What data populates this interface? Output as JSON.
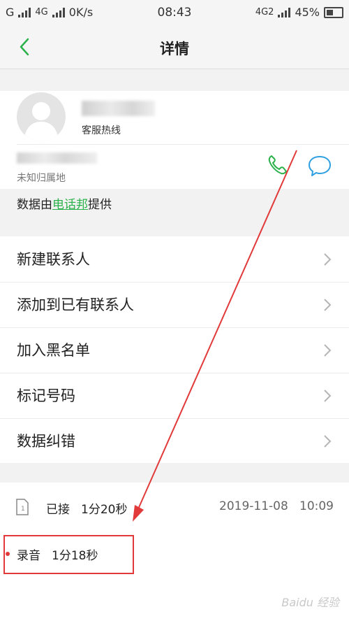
{
  "status_bar": {
    "network_left": "G",
    "network_mid": "4G",
    "speed": "0K/s",
    "time": "08:43",
    "network_right": "4G2",
    "battery_percent": "45%"
  },
  "nav": {
    "title": "详情"
  },
  "contact": {
    "subtitle": "客服热线",
    "location": "未知归属地"
  },
  "provider": {
    "prefix": "数据由",
    "link": "电话邦",
    "suffix": "提供"
  },
  "menu": {
    "items": [
      {
        "label": "新建联系人"
      },
      {
        "label": "添加到已有联系人"
      },
      {
        "label": "加入黑名单"
      },
      {
        "label": "标记号码"
      },
      {
        "label": "数据纠错"
      }
    ]
  },
  "call_log": {
    "status": "已接",
    "duration": "1分20秒",
    "datetime": "2019-11-08   10:09"
  },
  "recording": {
    "label": "录音",
    "duration": "1分18秒"
  },
  "watermark": "Baidu 经验",
  "colors": {
    "accent_green": "#2bb14a",
    "message_blue": "#2e9fe0",
    "annotation_red": "#e23a3a"
  }
}
